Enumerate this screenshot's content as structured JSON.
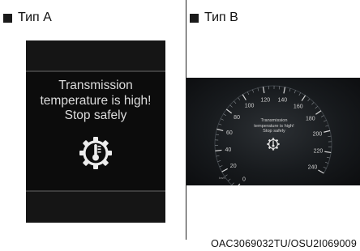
{
  "panels": {
    "a": {
      "label": "Тип A",
      "message": "Transmission temperature is high! Stop safely"
    },
    "b": {
      "label": "Тип B",
      "message": "Transmission temperature is high! Stop safely",
      "speedometer_ticks": [
        "0",
        "20",
        "40",
        "60",
        "80",
        "100",
        "120",
        "140",
        "160",
        "180",
        "200",
        "220",
        "240"
      ],
      "speedometer_unit": "km/h"
    }
  },
  "icon": "transmission-temperature-warning-icon",
  "reference_code": "OAC3069032TU/OSU2I069009",
  "colors": {
    "display_background": "#0c0c0c",
    "display_text": "#dcdcdc"
  }
}
